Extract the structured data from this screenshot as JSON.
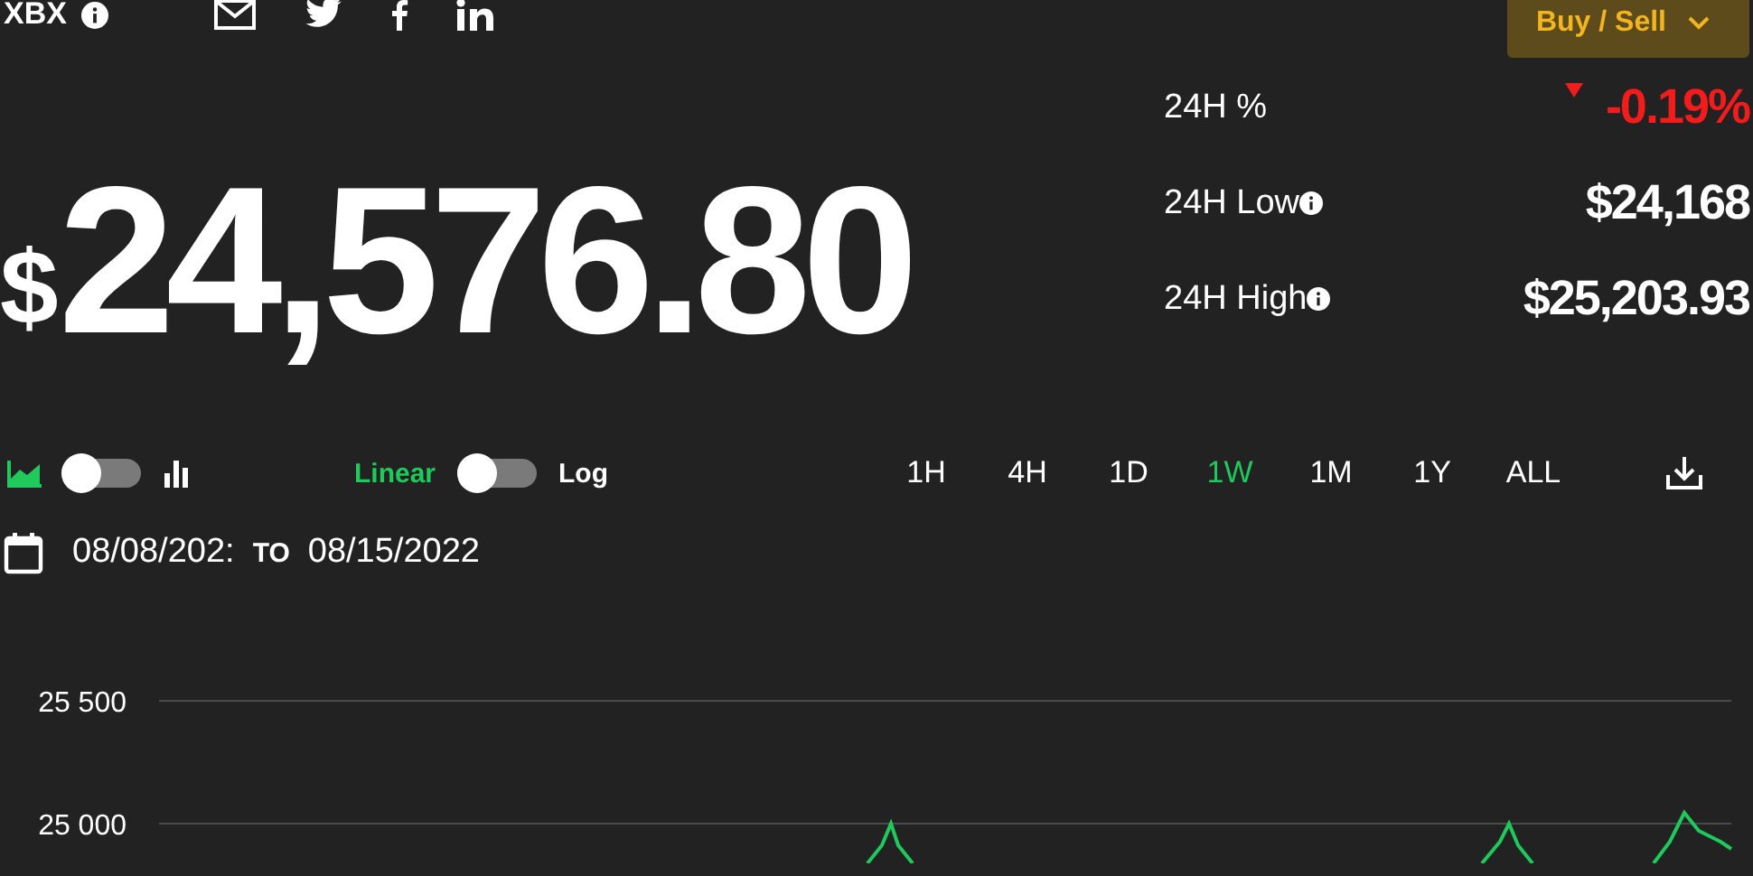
{
  "asset": {
    "symbol": "XBX"
  },
  "buy_sell_button": {
    "label": "Buy / Sell"
  },
  "price": {
    "currency": "$",
    "value": "24,576.80"
  },
  "stats": [
    {
      "label": "24H %",
      "value": "-0.19%",
      "kind": "change",
      "falling": true,
      "info": false
    },
    {
      "label": "24H Low",
      "value": "$24,168",
      "kind": "amount",
      "info": true
    },
    {
      "label": "24H High",
      "value": "$25,203.93",
      "kind": "amount",
      "info": true
    }
  ],
  "chart_type_switch": {
    "on": false
  },
  "scale_switch": {
    "left_label": "Linear",
    "right_label": "Log",
    "on": false
  },
  "timeframes": [
    {
      "label": "1H",
      "selected": false
    },
    {
      "label": "4H",
      "selected": false
    },
    {
      "label": "1D",
      "selected": false
    },
    {
      "label": "1W",
      "selected": true
    },
    {
      "label": "1M",
      "selected": false
    },
    {
      "label": "1Y",
      "selected": false
    },
    {
      "label": "ALL",
      "selected": false
    }
  ],
  "date_range": {
    "from": "08/08/202:",
    "separator": "TO",
    "to": "08/15/2022"
  },
  "chart": {
    "y_axis_labels": [
      "25 500",
      "25 000"
    ]
  }
}
